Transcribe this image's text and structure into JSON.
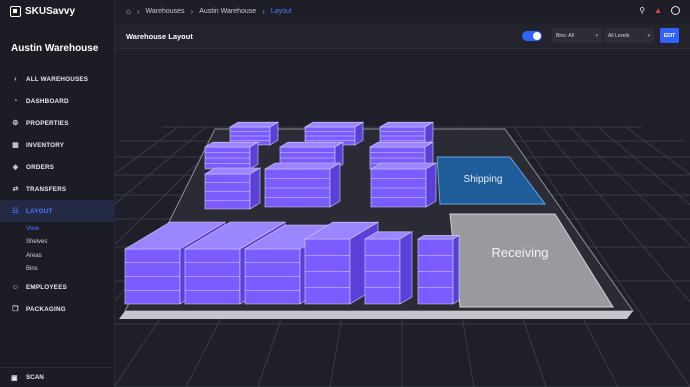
{
  "app": {
    "name": "SKUSavvy"
  },
  "warehouse": {
    "name": "Austin Warehouse"
  },
  "sidebar": {
    "items": [
      {
        "label": "ALL WAREHOUSES",
        "icon": "chevron-left-icon"
      },
      {
        "label": "DASHBOARD",
        "icon": "dashboard-icon"
      },
      {
        "label": "PROPERTIES",
        "icon": "gear-icon"
      },
      {
        "label": "INVENTORY",
        "icon": "inventory-icon"
      },
      {
        "label": "ORDERS",
        "icon": "tag-icon"
      },
      {
        "label": "TRANSFERS",
        "icon": "transfer-icon"
      },
      {
        "label": "LAYOUT",
        "icon": "layout-icon"
      },
      {
        "label": "EMPLOYEES",
        "icon": "people-icon"
      },
      {
        "label": "PACKAGING",
        "icon": "box-icon"
      }
    ],
    "layout_sub": [
      "View",
      "Shelves",
      "Areas",
      "Bins"
    ],
    "scan_label": "SCAN"
  },
  "breadcrumb": {
    "home": "home-icon",
    "items": [
      "Warehouses",
      "Austin Warehouse",
      "Layout"
    ]
  },
  "header": {
    "title": "Warehouse Layout",
    "bins_filter": "Bins: All",
    "levels_filter": "All Levels",
    "edit_label": "EDIT"
  },
  "layout": {
    "zones": [
      {
        "name": "Shipping",
        "color": "#1f5c9a"
      },
      {
        "name": "Receiving",
        "color": "#9a9a9e"
      }
    ]
  },
  "colors": {
    "accent": "#2f62ff",
    "shelf": "#7a5cff",
    "alert": "#e84545"
  }
}
